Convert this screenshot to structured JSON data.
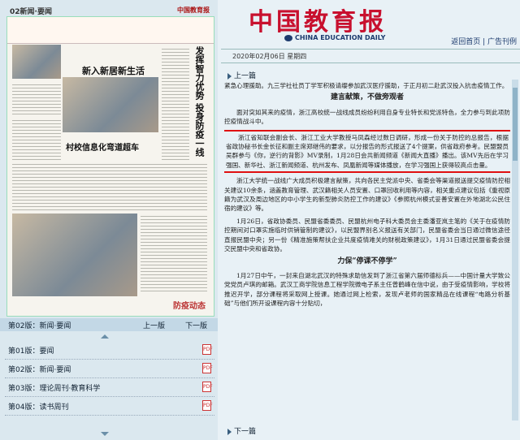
{
  "left": {
    "page_header": {
      "section": "02新闻·要闻",
      "masthead": "中国教育报"
    },
    "thumbnail": {
      "headline_1": "新入新居新生活",
      "headline_2": "村校信息化弯道超车",
      "vertical_1": "发挥智力优势 投身防疫一线",
      "corner_label": "防疫动态"
    },
    "pager": {
      "current": "第02版：新闻·要闻",
      "prev": "上一版",
      "next": "下一版"
    },
    "pages": [
      {
        "label": "第01版：要闻"
      },
      {
        "label": "第02版：新闻·要闻"
      },
      {
        "label": "第03版：理论周刊·教育科学"
      },
      {
        "label": "第04版：读书周刊"
      }
    ]
  },
  "header": {
    "logo_cn": "中国教育报",
    "logo_en": "CHINA EDUCATION DAILY",
    "links": "返回首页 | 广告刊例",
    "date": "2020年02月06日  星期四"
  },
  "nav": {
    "prev_article": "上一篇",
    "next_article": "下一篇"
  },
  "article": {
    "p1": "紧急心理援助。九三学社社员丁学军积极请缨参加武汉医疗援助，于正月初二赴武汉投入抗击疫情工作。",
    "h1": "建言献策，不做旁观者",
    "p2": "面对突如其来的疫情，浙江高校统一战线成员纷纷利用自身专业特长和党派特色，全力参与到此项防控疫情战斗中。",
    "p3": "浙江省知联会副会长、浙江工业大学教授马凤森经过数日调研，形成一份关于防控的总报告，根据省政协秘书长金长征和副主席郑继伟的要求，以分报告的形式报送了4个提案，供省政府参考。民盟盟员吴群参与《你，逆行的背影》MV录制，1月28日会共新闻频道《新闻大直播》播出。该MV先后在学习强国、新华社、浙江新闻频道、杭州发布、凤凰新闻等媒体播放，在学习强国上获得较高点击量。",
    "p4": "浙江大学统一战线广大成员积极建言献策，共向各民主党派中央、省委会等渠道报送提交疫情防控相关建议10余条，涵盖教育管理、武汉籍相关人员安置、口罩回收利用等内容，相关重点建议包括《重视原籍为武汉及周边地区的中小学生的新型肺炎防控工作的建议》《参照杭州模式妥善安置在外地湖北公民住宿的建议》等。",
    "p5": "1月26日，省政协委员、民盟省委委员、民盟杭州电子科大委员会主委潘亚岚主笔的《关于在疫情防控期间对口罩实施临时供销管制的建议》，以民盟界别名义报送有关部门，民盟省委会当日通过微信途径直报民盟中央；另一份《精准施策帮扶企业共度疫情难关的财税政策建议》，1月31日通过民盟省委会提交民盟中央和省政协。",
    "h2": "力保“停课不停学”",
    "p6": "1月27日中午，一封来自湖北武汉的特殊求助信发到了浙江省第六届师德标兵——中国计量大学致公党党员卢琪的邮箱。武汉工商学院信息工程学院微电子系主任曾鹤峰在信中说，由于受疫情影响，学校将推迟开学，部分课程将采取网上授课。她通过网上检索，发现卢老师的国家精品在线课程“电路分析基础”与他们所开设课程内容十分贴切，"
  }
}
